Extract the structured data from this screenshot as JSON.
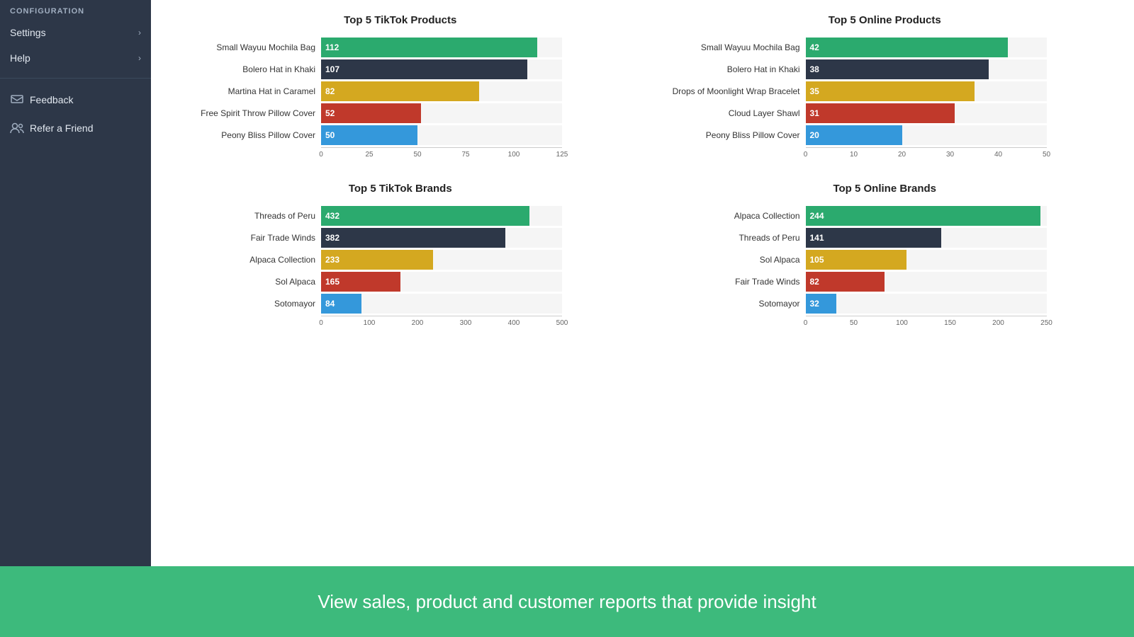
{
  "sidebar": {
    "config_label": "CONFIGURATION",
    "items": [
      {
        "label": "Settings",
        "has_chevron": true
      },
      {
        "label": "Help",
        "has_chevron": true
      }
    ],
    "bottom_items": [
      {
        "label": "Feedback",
        "icon": "feedback-icon"
      },
      {
        "label": "Refer a Friend",
        "icon": "refer-icon"
      }
    ]
  },
  "charts": {
    "top_left": {
      "title": "Top 5 TikTok Products",
      "max": 125,
      "axis_ticks": [
        0,
        25,
        50,
        75,
        100,
        125
      ],
      "bars": [
        {
          "label": "Small Wayuu Mochila Bag",
          "value": 112,
          "color": "green"
        },
        {
          "label": "Bolero Hat in Khaki",
          "value": 107,
          "color": "darkblue"
        },
        {
          "label": "Martina Hat in Caramel",
          "value": 82,
          "color": "gold"
        },
        {
          "label": "Free Spirit Throw Pillow Cover",
          "value": 52,
          "color": "red"
        },
        {
          "label": "Peony Bliss Pillow Cover",
          "value": 50,
          "color": "blue"
        }
      ]
    },
    "top_right": {
      "title": "Top 5 Online Products",
      "max": 50,
      "axis_ticks": [
        0,
        10,
        20,
        30,
        40,
        50
      ],
      "bars": [
        {
          "label": "Small Wayuu Mochila Bag",
          "value": 42,
          "color": "green"
        },
        {
          "label": "Bolero Hat in Khaki",
          "value": 38,
          "color": "darkblue"
        },
        {
          "label": "Drops of Moonlight Wrap Bracelet",
          "value": 35,
          "color": "gold"
        },
        {
          "label": "Cloud Layer Shawl",
          "value": 31,
          "color": "red"
        },
        {
          "label": "Peony Bliss Pillow Cover",
          "value": 20,
          "color": "blue"
        }
      ]
    },
    "bottom_left": {
      "title": "Top 5 TikTok Brands",
      "max": 500,
      "axis_ticks": [
        0,
        100,
        200,
        300,
        400,
        500
      ],
      "bars": [
        {
          "label": "Threads of Peru",
          "value": 432,
          "color": "green"
        },
        {
          "label": "Fair Trade Winds",
          "value": 382,
          "color": "darkblue"
        },
        {
          "label": "Alpaca Collection",
          "value": 233,
          "color": "gold"
        },
        {
          "label": "Sol Alpaca",
          "value": 165,
          "color": "red"
        },
        {
          "label": "Sotomayor",
          "value": 84,
          "color": "blue"
        }
      ]
    },
    "bottom_right": {
      "title": "Top 5 Online Brands",
      "max": 250,
      "axis_ticks": [
        0,
        50,
        100,
        150,
        200,
        250
      ],
      "bars": [
        {
          "label": "Alpaca Collection",
          "value": 244,
          "color": "green"
        },
        {
          "label": "Threads of Peru",
          "value": 141,
          "color": "darkblue"
        },
        {
          "label": "Sol Alpaca",
          "value": 105,
          "color": "gold"
        },
        {
          "label": "Fair Trade Winds",
          "value": 82,
          "color": "red"
        },
        {
          "label": "Sotomayor",
          "value": 32,
          "color": "blue"
        }
      ]
    }
  },
  "footer": {
    "text": "View sales, product and customer reports that provide insight"
  }
}
